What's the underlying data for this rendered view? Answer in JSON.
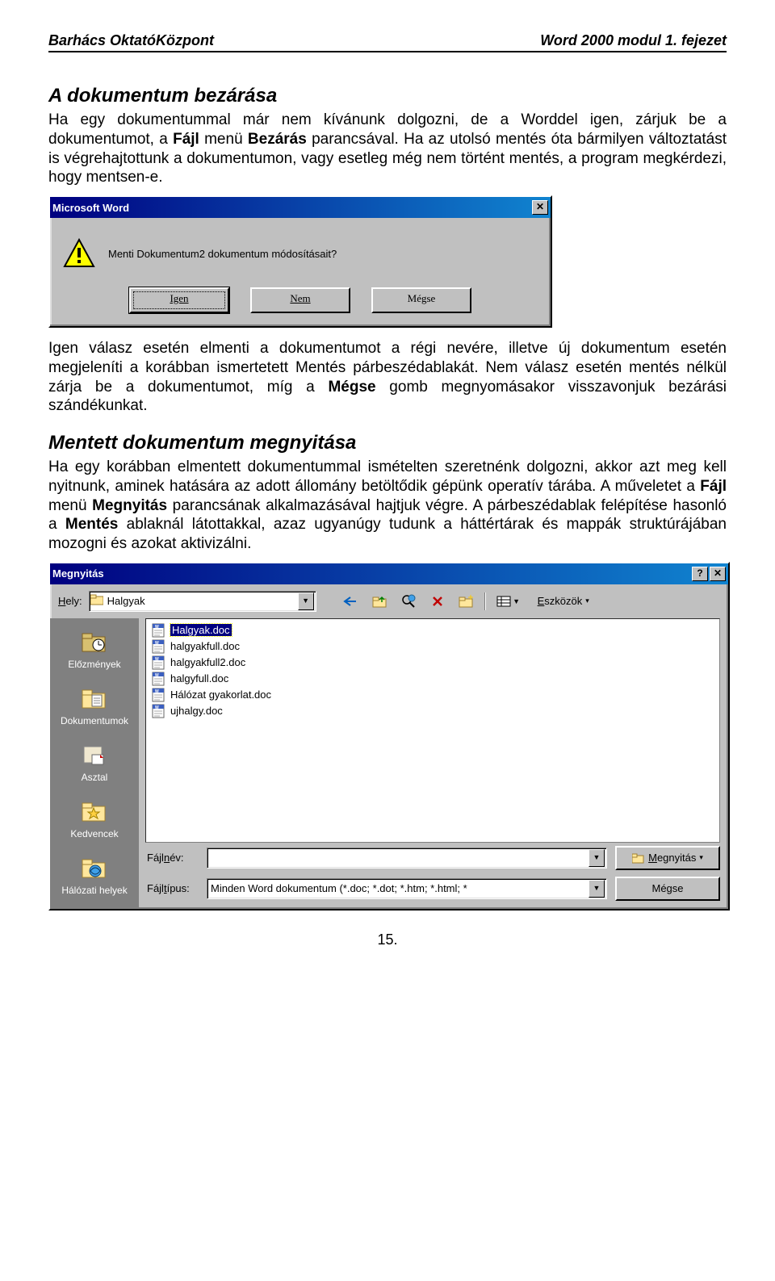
{
  "header": {
    "left": "Barhács OktatóKözpont",
    "right": "Word 2000 modul 1. fejezet"
  },
  "section1": {
    "title": "A dokumentum bezárása",
    "p1a": "Ha egy dokumentummal már nem kívánunk dolgozni, de a Worddel igen, zárjuk be a dokumentumot, a ",
    "p1b": "Fájl",
    "p1c": " menü ",
    "p1d": "Bezárás",
    "p1e": " parancsával. Ha az utolsó mentés óta bármilyen változtatást is végrehajtottunk a dokumentumon, vagy esetleg még nem történt mentés, a program megkérdezi, hogy mentsen-e."
  },
  "msgbox": {
    "title": "Microsoft Word",
    "text": "Menti Dokumentum2 dokumentum módosításait?",
    "yes": "Igen",
    "no": "Nem",
    "cancel": "Mégse"
  },
  "para2": {
    "a": "Igen válasz esetén elmenti a dokumentumot a régi nevére, illetve új dokumentum esetén megjeleníti a korábban ismertetett Mentés párbeszédablakát. Nem válasz esetén mentés nélkül zárja be a dokumentumot, míg a ",
    "b": "Mégse",
    "c": " gomb megnyomásakor visszavonjuk bezárási szándékunkat."
  },
  "section2": {
    "title": "Mentett dokumentum megnyitása",
    "p": "Ha egy korábban elmentett dokumentummal ismételten szeretnénk dolgozni, akkor azt meg kell nyitnunk, aminek hatására az adott állomány betöltődik gépünk operatív tárába. A műveletet a ",
    "b1": "Fájl",
    "p2": " menü ",
    "b2": "Megnyitás",
    "p3": " parancsának alkalmazásával hajtjuk végre. A párbeszédablak felépítése hasonló a ",
    "b3": "Mentés",
    "p4": " ablaknál látottakkal, azaz ugyanúgy tudunk a háttértárak és mappák struktúrájában mozogni és azokat aktivizálni."
  },
  "opendlg": {
    "title": "Megnyitás",
    "hely_label": "Hely:",
    "hely_value": "Halgyak",
    "tools": "Eszközök",
    "places": [
      {
        "label": "Előzmények"
      },
      {
        "label": "Dokumentumok"
      },
      {
        "label": "Asztal"
      },
      {
        "label": "Kedvencek"
      },
      {
        "label": "Hálózati helyek"
      }
    ],
    "files": [
      {
        "name": "Halgyak.doc",
        "selected": true
      },
      {
        "name": "halgyakfull.doc"
      },
      {
        "name": "halgyakfull2.doc"
      },
      {
        "name": "halgyfull.doc"
      },
      {
        "name": "Hálózat gyakorlat.doc"
      },
      {
        "name": "ujhalgy.doc"
      }
    ],
    "fname_label": "Fájlnév:",
    "fname_value": "",
    "ftype_label": "Fájltípus:",
    "ftype_value": "Minden Word dokumentum (*.doc; *.dot; *.htm; *.html; *",
    "open_btn": "Megnyitás",
    "cancel_btn": "Mégse"
  },
  "footer": {
    "pagenum": "15."
  }
}
